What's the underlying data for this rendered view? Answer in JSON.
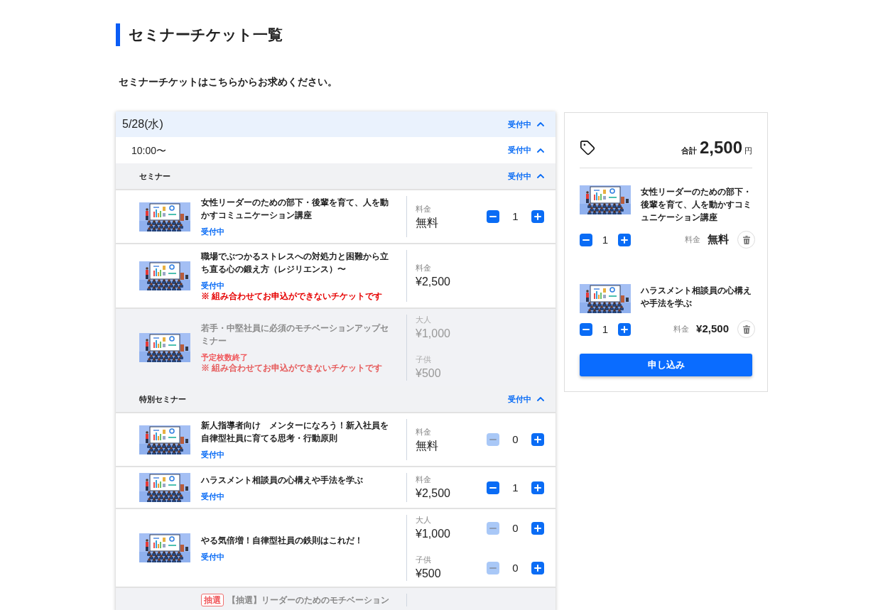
{
  "page": {
    "title": "セミナーチケット一覧",
    "intro": "セミナーチケットはこちらからお求めください。"
  },
  "schedule": {
    "date": "5/28(水)",
    "status": "受付中",
    "expanded": true,
    "sessions": [
      {
        "time": "10:00〜",
        "status": "受付中",
        "expanded": true,
        "categories": [
          {
            "name": "セミナー",
            "status": "受付中",
            "expanded": true,
            "tickets": [
              {
                "title": "女性リーダーのための部下・後輩を育て、人を動かすコミュニケーション講座",
                "status": "受付中",
                "sold_out": false,
                "available": true,
                "prices": [
                  {
                    "label": "料金",
                    "amount": "無料",
                    "stepper": {
                      "count": "1",
                      "minus_disabled": false
                    }
                  }
                ]
              },
              {
                "title": "職場でぶつかるストレスへの対処力と困難から立ち直る心の鍛え方（レジリエンス）〜",
                "status": "受付中",
                "sold_out": false,
                "available": true,
                "note": "※ 組み合わせてお申込ができないチケットです",
                "prices": [
                  {
                    "label": "料金",
                    "amount": "¥2,500"
                  }
                ]
              },
              {
                "title": "若手・中堅社員に必須のモチベーションアップセミナー",
                "status": "予定枚数終了",
                "sold_out": true,
                "available": false,
                "note": "※ 組み合わせてお申込ができないチケットです",
                "prices": [
                  {
                    "label": "大人",
                    "amount": "¥1,000"
                  },
                  {
                    "label": "子供",
                    "amount": "¥500"
                  }
                ]
              }
            ]
          },
          {
            "name": "特別セミナー",
            "status": "受付中",
            "expanded": true,
            "tickets": [
              {
                "title": "新人指導者向け　メンターになろう！新入社員を自律型社員に育てる思考・行動原則",
                "status": "受付中",
                "sold_out": false,
                "available": true,
                "prices": [
                  {
                    "label": "料金",
                    "amount": "無料",
                    "stepper": {
                      "count": "0",
                      "minus_disabled": true
                    }
                  }
                ]
              },
              {
                "title": "ハラスメント相談員の心構えや手法を学ぶ",
                "status": "受付中",
                "sold_out": false,
                "available": true,
                "prices": [
                  {
                    "label": "料金",
                    "amount": "¥2,500",
                    "stepper": {
                      "count": "1",
                      "minus_disabled": false
                    }
                  }
                ]
              },
              {
                "title": "やる気倍増！自律型社員の鉄則はこれだ！",
                "status": "受付中",
                "sold_out": false,
                "available": true,
                "prices": [
                  {
                    "label": "大人",
                    "amount": "¥1,000",
                    "stepper": {
                      "count": "0",
                      "minus_disabled": true
                    }
                  },
                  {
                    "label": "子供",
                    "amount": "¥500",
                    "stepper": {
                      "count": "0",
                      "minus_disabled": true
                    }
                  }
                ]
              },
              {
                "badge": "抽選",
                "title": "【抽選】リーダーのためのモチベーション",
                "available": false
              }
            ]
          }
        ]
      }
    ]
  },
  "cart": {
    "total_label": "合計",
    "total": "2,500",
    "currency": "円",
    "items": [
      {
        "title": "女性リーダーのための部下・後輩を育て、人を動かすコミュニケーション講座",
        "count": "1",
        "minus_disabled": false,
        "price_label": "料金",
        "price": "無料"
      },
      {
        "title": "ハラスメント相談員の心構えや手法を学ぶ",
        "count": "1",
        "minus_disabled": false,
        "price_label": "料金",
        "price": "¥2,500"
      }
    ],
    "submit": "申し込み"
  }
}
